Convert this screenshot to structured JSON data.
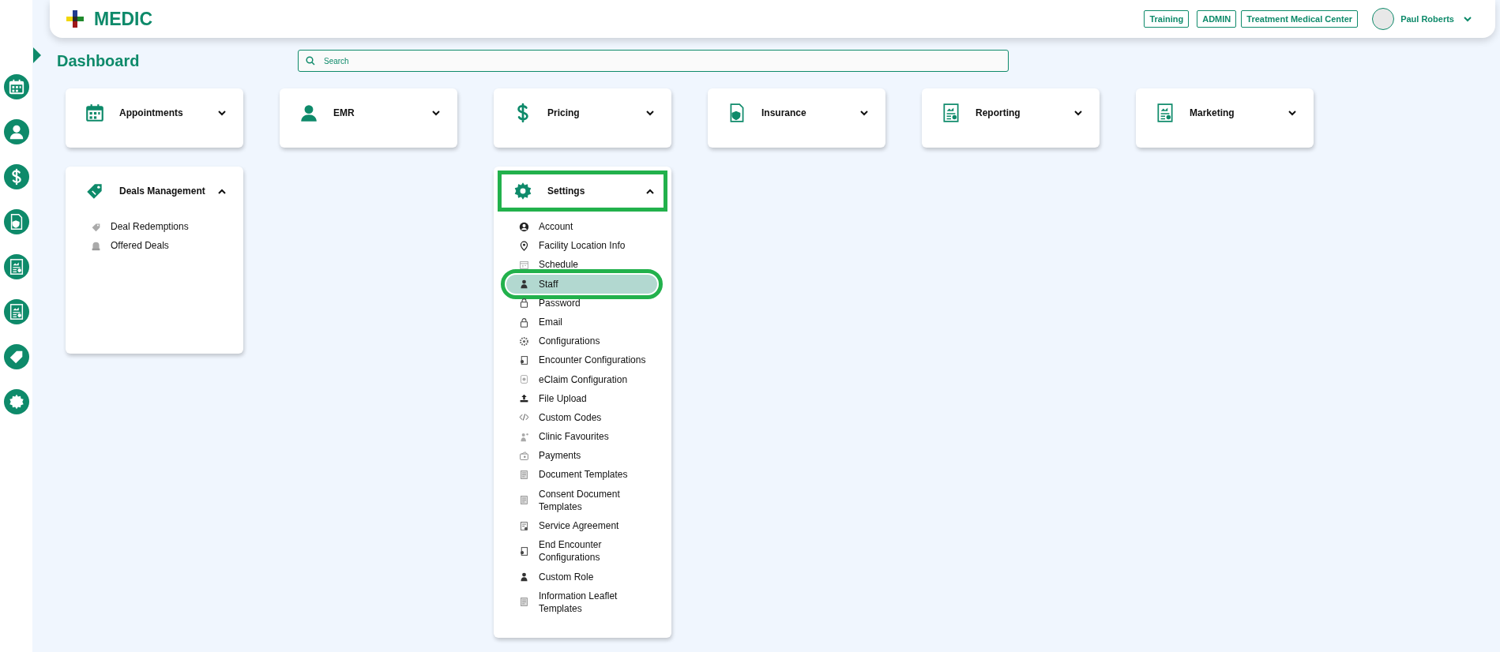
{
  "header": {
    "logo": "MEDIC",
    "tags": [
      "Training",
      "ADMIN",
      "Treatment Medical Center"
    ],
    "user": "Paul Roberts"
  },
  "page": {
    "title": "Dashboard"
  },
  "search": {
    "placeholder": "Search"
  },
  "sections": [
    {
      "title": "Appointments",
      "expanded": false
    },
    {
      "title": "EMR",
      "expanded": false
    },
    {
      "title": "Pricing",
      "expanded": false
    },
    {
      "title": "Insurance",
      "expanded": false
    },
    {
      "title": "Reporting",
      "expanded": false
    },
    {
      "title": "Marketing",
      "expanded": false
    },
    {
      "title": "Deals Management",
      "expanded": true,
      "items": [
        {
          "label": "Deal Redemptions",
          "selected": false,
          "highlighted": false
        },
        {
          "label": "Offered Deals",
          "selected": false,
          "highlighted": false
        }
      ]
    },
    {
      "title": "Settings",
      "expanded": true,
      "highlighted": true,
      "items": [
        {
          "label": "Account",
          "selected": false,
          "highlighted": false
        },
        {
          "label": "Facility Location Info",
          "selected": false,
          "highlighted": false
        },
        {
          "label": "Schedule",
          "selected": false,
          "highlighted": false
        },
        {
          "label": "Staff",
          "selected": true,
          "highlighted": true
        },
        {
          "label": "Password",
          "selected": false,
          "highlighted": false
        },
        {
          "label": "Email",
          "selected": false,
          "highlighted": false
        },
        {
          "label": "Configurations",
          "selected": false,
          "highlighted": false
        },
        {
          "label": "Encounter Configurations",
          "selected": false,
          "highlighted": false
        },
        {
          "label": "eClaim Configuration",
          "selected": false,
          "highlighted": false
        },
        {
          "label": "File Upload",
          "selected": false,
          "highlighted": false
        },
        {
          "label": "Custom Codes",
          "selected": false,
          "highlighted": false
        },
        {
          "label": "Clinic Favourites",
          "selected": false,
          "highlighted": false
        },
        {
          "label": "Payments",
          "selected": false,
          "highlighted": false
        },
        {
          "label": "Document Templates",
          "selected": false,
          "highlighted": false
        },
        {
          "label": "Consent Document Templates",
          "selected": false,
          "highlighted": false
        },
        {
          "label": "Service Agreement",
          "selected": false,
          "highlighted": false
        },
        {
          "label": "End Encounter Configurations",
          "selected": false,
          "highlighted": false
        },
        {
          "label": "Custom Role",
          "selected": false,
          "highlighted": false
        },
        {
          "label": "Information Leaflet Templates",
          "selected": false,
          "highlighted": false
        }
      ]
    }
  ]
}
